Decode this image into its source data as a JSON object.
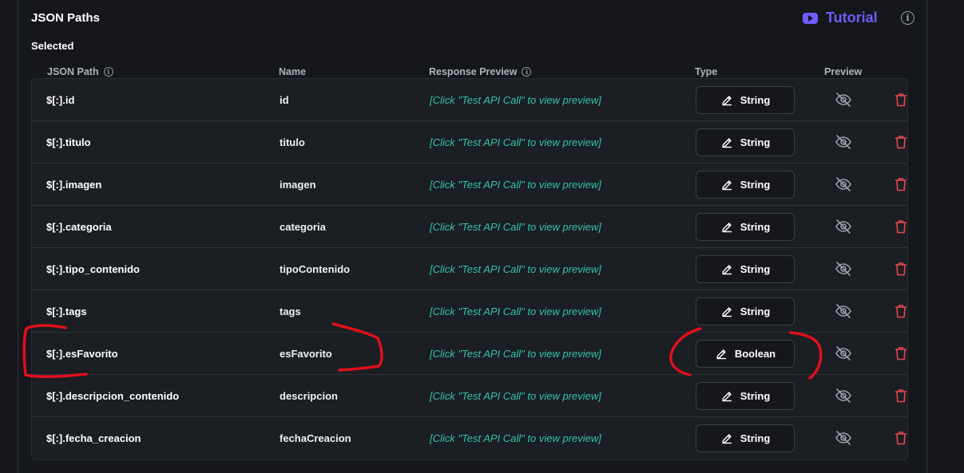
{
  "panel": {
    "title": "JSON Paths",
    "tutorial_label": "Tutorial",
    "selected_label": "Selected"
  },
  "columns": {
    "json_path": "JSON Path",
    "name": "Name",
    "response_preview": "Response Preview",
    "type": "Type",
    "preview": "Preview"
  },
  "rows": [
    {
      "path": "$[:].id",
      "name": "id",
      "preview": "[Click \"Test API Call\" to view preview]",
      "type": "String"
    },
    {
      "path": "$[:].titulo",
      "name": "titulo",
      "preview": "[Click \"Test API Call\" to view preview]",
      "type": "String"
    },
    {
      "path": "$[:].imagen",
      "name": "imagen",
      "preview": "[Click \"Test API Call\" to view preview]",
      "type": "String"
    },
    {
      "path": "$[:].categoria",
      "name": "categoria",
      "preview": "[Click \"Test API Call\" to view preview]",
      "type": "String"
    },
    {
      "path": "$[:].tipo_contenido",
      "name": "tipoContenido",
      "preview": "[Click \"Test API Call\" to view preview]",
      "type": "String"
    },
    {
      "path": "$[:].tags",
      "name": "tags",
      "preview": "[Click \"Test API Call\" to view preview]",
      "type": "String"
    },
    {
      "path": "$[:].esFavorito",
      "name": "esFavorito",
      "preview": "[Click \"Test API Call\" to view preview]",
      "type": "Boolean"
    },
    {
      "path": "$[:].descripcion_contenido",
      "name": "descripcion",
      "preview": "[Click \"Test API Call\" to view preview]",
      "type": "String"
    },
    {
      "path": "$[:].fecha_creacion",
      "name": "fechaCreacion",
      "preview": "[Click \"Test API Call\" to view preview]",
      "type": "String"
    }
  ],
  "icons": {
    "tutorial": "youtube-icon",
    "info": "info-icon",
    "type_button": "pencil-icon",
    "preview_toggle": "eye-off-icon",
    "delete": "trash-icon"
  },
  "colors": {
    "accent": "#6f5dff",
    "preview_text": "#34c3a4",
    "delete": "#e5484d",
    "annotation": "#e0101a"
  }
}
